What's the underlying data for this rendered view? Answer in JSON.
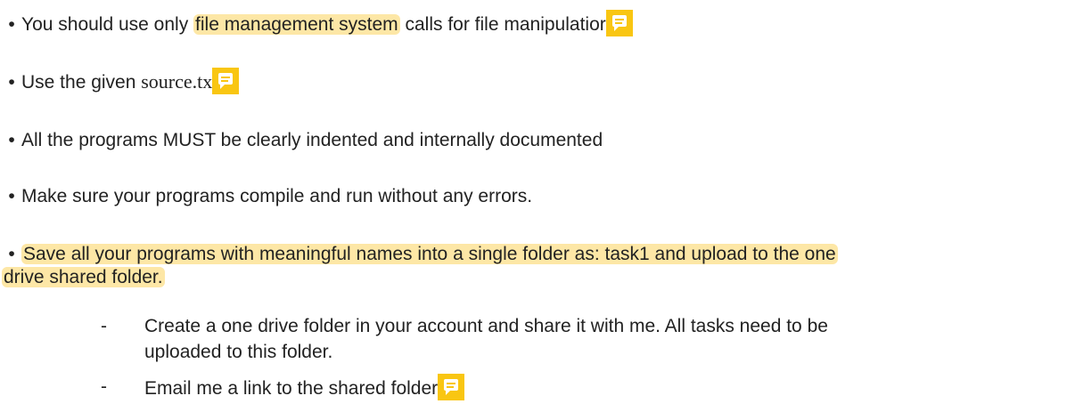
{
  "bullets": [
    {
      "marker": "•",
      "pre": "You should use only ",
      "highlight": "file management system",
      "post": " calls for file manipulatior"
    },
    {
      "marker": "•",
      "pre": "Use the given ",
      "serif": "source.tx"
    },
    {
      "marker": "•",
      "text": "All the programs MUST be clearly indented and internally documented"
    },
    {
      "marker": "•",
      "text": "Make sure your programs compile and run without any errors."
    },
    {
      "marker": "•",
      "highlight_line1": "Save all your programs with meaningful names into a single folder as: task1 and upload to the one",
      "highlight_line2": "drive shared folder."
    }
  ],
  "sub_items": [
    {
      "marker": "-",
      "line1": "Create a one drive folder in your account and share it with me. All tasks need to be",
      "line2": "uploaded to this folder."
    },
    {
      "marker": "-",
      "line1": "Email me a link to the shared folder"
    }
  ],
  "comment_icon_color": "#f9c612",
  "highlight_color": "#fde7a6"
}
